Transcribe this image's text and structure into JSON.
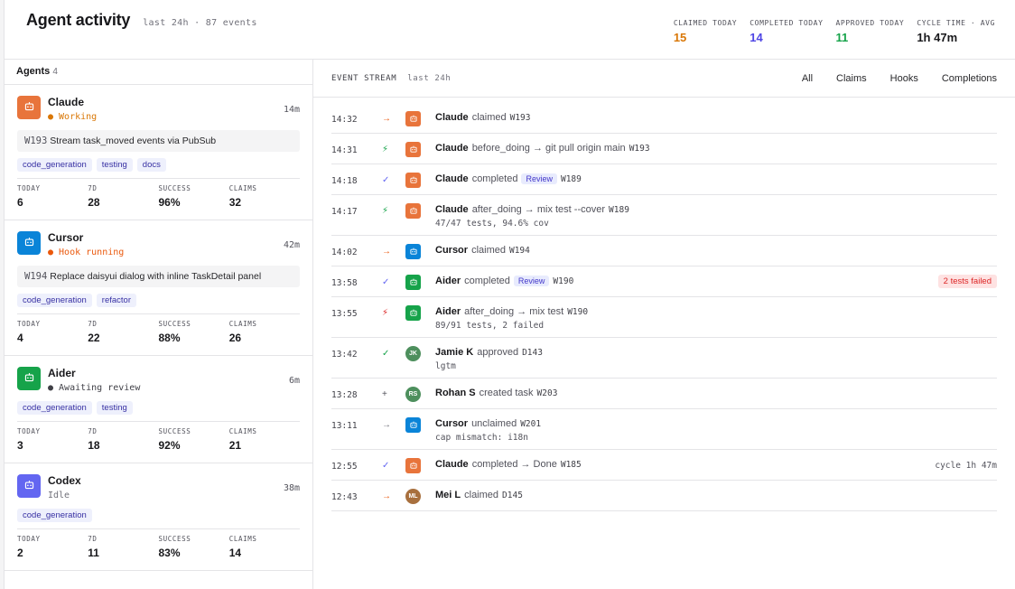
{
  "header": {
    "title": "Agent activity",
    "subtitle": "last 24h · 87 events",
    "stats": [
      {
        "label": "CLAIMED TODAY",
        "value": "15",
        "color": "#d97706"
      },
      {
        "label": "COMPLETED TODAY",
        "value": "14",
        "color": "#4f46e5"
      },
      {
        "label": "APPROVED TODAY",
        "value": "11",
        "color": "#16a34a"
      },
      {
        "label": "CYCLE TIME · AVG",
        "value": "1h 47m",
        "color": "#18181b"
      }
    ]
  },
  "agents_panel": {
    "title": "Agents",
    "count": "4"
  },
  "agents": [
    {
      "name": "Claude",
      "status": "● Working",
      "status_color": "#d97706",
      "age": "14m",
      "avatar_color": "#e8743b",
      "icon": "robot-icon",
      "task_id": "W193",
      "task_title": "Stream task_moved events via PubSub",
      "tags": [
        "code_generation",
        "testing",
        "docs"
      ],
      "stats": [
        {
          "label": "TODAY",
          "value": "6"
        },
        {
          "label": "7D",
          "value": "28"
        },
        {
          "label": "SUCCESS",
          "value": "96%"
        },
        {
          "label": "CLAIMS",
          "value": "32"
        }
      ]
    },
    {
      "name": "Cursor",
      "status": "● Hook running",
      "status_color": "#ea580c",
      "age": "42m",
      "avatar_color": "#0a84d8",
      "icon": "robot-icon",
      "task_id": "W194",
      "task_title": "Replace daisyui dialog with inline TaskDetail panel",
      "tags": [
        "code_generation",
        "refactor"
      ],
      "stats": [
        {
          "label": "TODAY",
          "value": "4"
        },
        {
          "label": "7D",
          "value": "22"
        },
        {
          "label": "SUCCESS",
          "value": "88%"
        },
        {
          "label": "CLAIMS",
          "value": "26"
        }
      ]
    },
    {
      "name": "Aider",
      "status": "● Awaiting review",
      "status_color": "#3f3f46",
      "age": "6m",
      "avatar_color": "#16a34a",
      "icon": "robot-icon",
      "task_id": "",
      "task_title": "",
      "tags": [
        "code_generation",
        "testing"
      ],
      "stats": [
        {
          "label": "TODAY",
          "value": "3"
        },
        {
          "label": "7D",
          "value": "18"
        },
        {
          "label": "SUCCESS",
          "value": "92%"
        },
        {
          "label": "CLAIMS",
          "value": "21"
        }
      ]
    },
    {
      "name": "Codex",
      "status": "Idle",
      "status_color": "#71717a",
      "age": "38m",
      "avatar_color": "#6366f1",
      "icon": "robot-icon",
      "task_id": "",
      "task_title": "",
      "tags": [
        "code_generation"
      ],
      "stats": [
        {
          "label": "TODAY",
          "value": "2"
        },
        {
          "label": "7D",
          "value": "11"
        },
        {
          "label": "SUCCESS",
          "value": "83%"
        },
        {
          "label": "CLAIMS",
          "value": "14"
        }
      ]
    }
  ],
  "stream": {
    "title": "EVENT STREAM",
    "subtitle": "last 24h",
    "filters": [
      "All",
      "Claims",
      "Hooks",
      "Completions"
    ],
    "events": [
      {
        "time": "14:32",
        "type": "claim",
        "glyph": "→",
        "glyph_color": "#ea580c",
        "actor": "Claude",
        "avatar": "robot",
        "avatar_color": "#e8743b",
        "action": "claimed",
        "ref": "W193"
      },
      {
        "time": "14:31",
        "type": "hook",
        "glyph": "⚡",
        "glyph_color": "#16a34a",
        "actor": "Claude",
        "avatar": "robot",
        "avatar_color": "#e8743b",
        "action": "before_doing → git pull origin main",
        "ref": "W193"
      },
      {
        "time": "14:18",
        "type": "complete",
        "glyph": "✓",
        "glyph_color": "#6366f1",
        "actor": "Claude",
        "avatar": "robot",
        "avatar_color": "#e8743b",
        "action": "completed",
        "badge": "Review",
        "ref": "W189"
      },
      {
        "time": "14:17",
        "type": "hook",
        "glyph": "⚡",
        "glyph_color": "#16a34a",
        "actor": "Claude",
        "avatar": "robot",
        "avatar_color": "#e8743b",
        "action": "after_doing → mix test --cover",
        "ref": "W189",
        "sub": "47/47 tests, 94.6% cov"
      },
      {
        "time": "14:02",
        "type": "claim",
        "glyph": "→",
        "glyph_color": "#ea580c",
        "actor": "Cursor",
        "avatar": "robot",
        "avatar_color": "#0a84d8",
        "action": "claimed",
        "ref": "W194"
      },
      {
        "time": "13:58",
        "type": "complete",
        "glyph": "✓",
        "glyph_color": "#6366f1",
        "actor": "Aider",
        "avatar": "robot",
        "avatar_color": "#16a34a",
        "action": "completed",
        "badge": "Review",
        "ref": "W190",
        "fail": "2 tests failed"
      },
      {
        "time": "13:55",
        "type": "hook",
        "glyph": "⚡",
        "glyph_color": "#dc2626",
        "actor": "Aider",
        "avatar": "robot",
        "avatar_color": "#16a34a",
        "action": "after_doing → mix test",
        "ref": "W190",
        "sub": "89/91 tests, 2 failed"
      },
      {
        "time": "13:42",
        "type": "approve",
        "glyph": "✓",
        "glyph_color": "#16a34a",
        "actor": "Jamie K",
        "avatar": "JK",
        "avatar_color": "#4d8f5d",
        "action": "approved",
        "ref": "D143",
        "sub": "lgtm"
      },
      {
        "time": "13:28",
        "type": "create",
        "glyph": "+",
        "glyph_color": "#52525b",
        "actor": "Rohan S",
        "avatar": "RS",
        "avatar_color": "#4d8f5d",
        "action": "created task",
        "ref": "W203"
      },
      {
        "time": "13:11",
        "type": "unclaim",
        "glyph": "→",
        "glyph_color": "#71717a",
        "actor": "Cursor",
        "avatar": "robot",
        "avatar_color": "#0a84d8",
        "action": "unclaimed",
        "ref": "W201",
        "sub": "cap mismatch: i18n"
      },
      {
        "time": "12:55",
        "type": "complete",
        "glyph": "✓",
        "glyph_color": "#6366f1",
        "actor": "Claude",
        "avatar": "robot",
        "avatar_color": "#e8743b",
        "action": "completed → Done",
        "ref": "W185",
        "right": "cycle 1h 47m"
      },
      {
        "time": "12:43",
        "type": "claim",
        "glyph": "→",
        "glyph_color": "#ea580c",
        "actor": "Mei L",
        "avatar": "ML",
        "avatar_color": "#a8703e",
        "action": "claimed",
        "ref": "D145"
      }
    ]
  }
}
